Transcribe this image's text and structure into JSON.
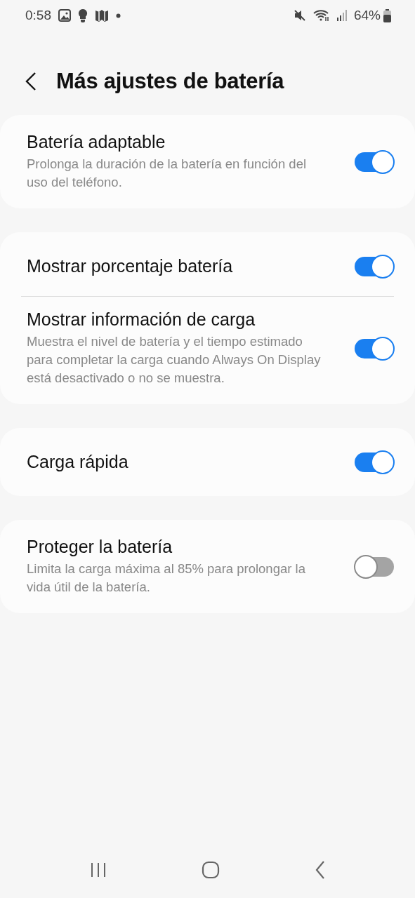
{
  "status_bar": {
    "time": "0:58",
    "battery": "64%"
  },
  "header": {
    "title": "Más ajustes de batería"
  },
  "groups": [
    {
      "items": [
        {
          "title": "Batería adaptable",
          "subtitle": "Prolonga la duración de la batería en función del uso del teléfono.",
          "on": true
        }
      ]
    },
    {
      "items": [
        {
          "title": "Mostrar porcentaje batería",
          "on": true
        },
        {
          "title": "Mostrar información de carga",
          "subtitle": "Muestra el nivel de batería y el tiempo estimado para completar la carga cuando Always On Display está desactivado o no se muestra.",
          "on": true
        }
      ]
    },
    {
      "items": [
        {
          "title": "Carga rápida",
          "on": true
        }
      ]
    },
    {
      "items": [
        {
          "title": "Proteger la batería",
          "subtitle": "Limita la carga máxima al 85% para prolongar la vida útil de la batería.",
          "on": false
        }
      ]
    }
  ]
}
